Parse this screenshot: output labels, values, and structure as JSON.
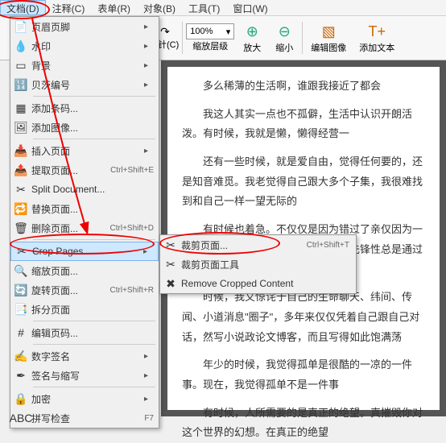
{
  "menubar": {
    "items": [
      "文档(D)",
      "注释(C)",
      "表单(R)",
      "对象(B)",
      "工具(T)",
      "窗口(W)"
    ]
  },
  "toolbar": {
    "rotate": "顺时针(C)",
    "zoom_value": "100%",
    "zoom_label": "缩放层级",
    "fit": "放大",
    "shrink": "缩小",
    "edit_image": "编辑图像",
    "add_text": "添加文本"
  },
  "dropdown": {
    "items": [
      {
        "icon": "📄",
        "label": "页眉页脚",
        "arrow": true
      },
      {
        "icon": "💧",
        "label": "水印",
        "arrow": true
      },
      {
        "icon": "▭",
        "label": "背景",
        "arrow": true
      },
      {
        "icon": "🔢",
        "label": "贝茨编号",
        "arrow": true
      },
      {
        "sep": true
      },
      {
        "icon": "▦",
        "label": "添加条码...",
        "arrow": false
      },
      {
        "icon": "🖼",
        "label": "添加图像...",
        "arrow": false
      },
      {
        "sep": true
      },
      {
        "icon": "📥",
        "label": "插入页面",
        "arrow": true
      },
      {
        "icon": "📤",
        "label": "提取页面...",
        "accel": "Ctrl+Shift+E"
      },
      {
        "icon": "✂",
        "label": "Split Document...",
        "arrow": false
      },
      {
        "icon": "🔁",
        "label": "替换页面...",
        "arrow": false
      },
      {
        "icon": "🗑",
        "label": "删除页面...",
        "accel": "Ctrl+Shift+D"
      },
      {
        "sep": true
      },
      {
        "icon": "✂",
        "label": "Crop Pages",
        "arrow": true,
        "hl": true
      },
      {
        "icon": "🔍",
        "label": "缩放页面...",
        "arrow": false
      },
      {
        "icon": "🔄",
        "label": "旋转页面...",
        "accel": "Ctrl+Shift+R"
      },
      {
        "icon": "📑",
        "label": "拆分页面",
        "arrow": false
      },
      {
        "sep": true
      },
      {
        "icon": "#",
        "label": "编辑页码...",
        "arrow": false
      },
      {
        "sep": true
      },
      {
        "icon": "✍",
        "label": "数字签名",
        "arrow": true
      },
      {
        "icon": "✒",
        "label": "签名与缩写",
        "arrow": true
      },
      {
        "sep": true
      },
      {
        "icon": "🔒",
        "label": "加密",
        "arrow": true
      },
      {
        "icon": "ABC",
        "label": "拼写检查",
        "accel": "F7"
      }
    ]
  },
  "submenu": {
    "items": [
      {
        "icon": "✂",
        "label": "裁剪页面...",
        "accel": "Ctrl+Shift+T"
      },
      {
        "icon": "✂",
        "label": "裁剪页面工具"
      },
      {
        "icon": "✖",
        "label": "Remove Cropped Content"
      }
    ]
  },
  "document": {
    "p1": "多么稀薄的生活啊，谁跟我接近了都会",
    "p2": "我这人其实一点也不孤僻，生活中认识开朗活泼。有时候，我就是懒，懒得经营一",
    "p3": "还有一些时候，就是爱自由，觉得任何要的，还是知音难觅。我老觉得自己跟大多个子集，我很难找到和自己一样一望无际的",
    "p4": "有时候也着急。不仅仅是因为错过了亲仅因为一个文学女青年对故事、冲突、枝蔓齿先锋性总是通过碰撞来保持的迫傻？",
    "p5": "时候，我又惊诧于自己的生命聊天、纬间、传闻、小道消息\"圈子\"，多年来仅仅凭着自己跟自己对话，然写小说政论文博客，而且写得如此饱满荡",
    "p6": "年少的时候，我觉得孤单是很酷的一凉的一件事。现在，我觉得孤单不是一件事",
    "p7": "有时候，人所需要的是真正的绝望。真摧毁你对这个世界的幻想。在真正的绝望"
  }
}
